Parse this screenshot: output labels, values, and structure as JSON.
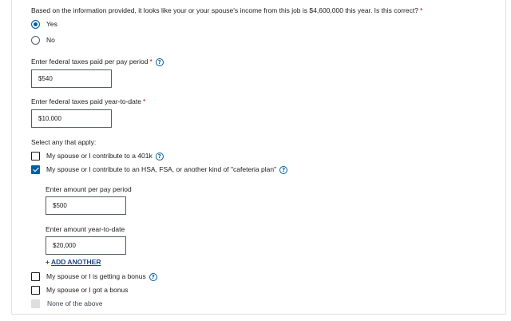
{
  "question": {
    "text": "Based on the information provided, it looks like your or your spouse's income from this job is $4,600,000 this year. Is this correct?",
    "required_mark": "*",
    "options": [
      {
        "label": "Yes",
        "selected": true
      },
      {
        "label": "No",
        "selected": false
      }
    ]
  },
  "fed_per_period": {
    "label": "Enter federal taxes paid per pay period",
    "required_mark": "*",
    "value": "$540"
  },
  "fed_ytd": {
    "label": "Enter federal taxes paid year-to-date",
    "required_mark": "*",
    "value": "$10,000"
  },
  "apply": {
    "label": "Select any that apply:",
    "options": [
      {
        "label": "My spouse or I contribute to a 401k",
        "checked": false,
        "help": true
      },
      {
        "label": "My spouse or I contribute to an HSA, FSA, or another kind of \"cafeteria plan\"",
        "checked": true,
        "help": true
      },
      {
        "label": "My spouse or I is getting a bonus",
        "checked": false,
        "help": true
      },
      {
        "label": "My spouse or I got a bonus",
        "checked": false,
        "help": false
      },
      {
        "label": "None of the above",
        "checked": false,
        "disabled": true
      }
    ]
  },
  "cafeteria": {
    "per_period_label": "Enter amount per pay period",
    "per_period_value": "$500",
    "ytd_label": "Enter amount year-to-date",
    "ytd_value": "$20,000",
    "add_another": "ADD ANOTHER"
  },
  "colors": {
    "primary": "#005ea2",
    "link": "#1a4480",
    "required": "#b50909",
    "disabled": "#dcdee0"
  },
  "icons": {
    "help": "question-circle-icon",
    "plus": "plus-icon",
    "check": "checkmark-icon"
  }
}
